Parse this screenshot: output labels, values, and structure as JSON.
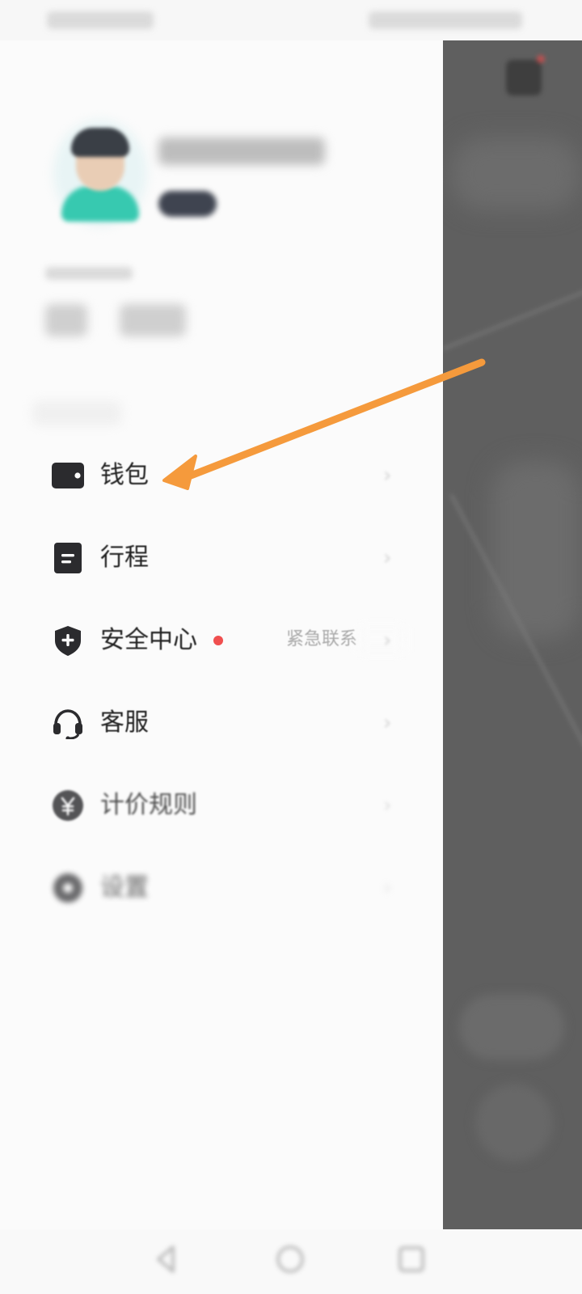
{
  "drawer": {
    "menu": [
      {
        "id": "wallet",
        "label": "钱包",
        "icon": "wallet-icon"
      },
      {
        "id": "trips",
        "label": "行程",
        "icon": "document-icon"
      },
      {
        "id": "safety",
        "label": "安全中心",
        "icon": "shield-plus-icon",
        "badge_color": "#f04f4f",
        "hint": "紧急联系"
      },
      {
        "id": "service",
        "label": "客服",
        "icon": "headset-icon"
      },
      {
        "id": "pricing",
        "label": "计价规则",
        "icon": "yen-icon"
      },
      {
        "id": "settings",
        "label": "设置",
        "icon": "gear-icon"
      }
    ]
  },
  "colors": {
    "arrow": "#f59a3c",
    "map_overlay": "#5f5f5f",
    "badge": "#f04f4f"
  }
}
